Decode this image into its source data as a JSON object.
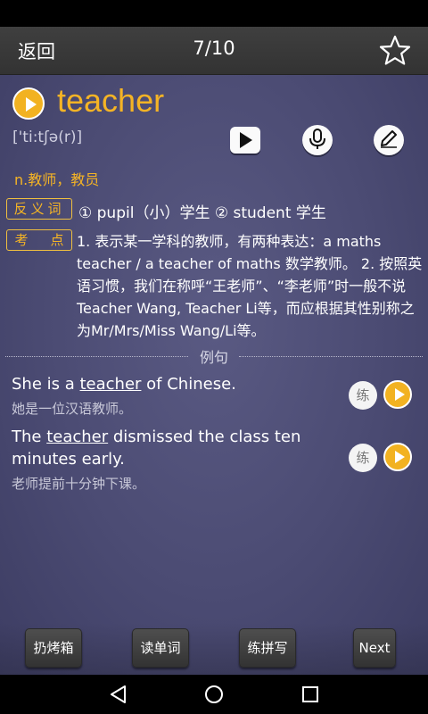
{
  "header": {
    "back_label": "返回",
    "progress": "7/10"
  },
  "word": {
    "text": "teacher",
    "phonetic": "['ti:tʃə(r)]",
    "pos_meaning": "n.教师，教员"
  },
  "antonym": {
    "tag": "反义词",
    "text": "① pupil（小）学生 ② student 学生"
  },
  "key_point": {
    "tag_left": "考",
    "tag_right": "点",
    "text": "1. 表示某一学科的教师，有两种表达：a maths teacher / a teacher of maths 数学教师。 2. 按照英语习惯，我们在称呼“王老师”、“李老师”时一般不说Teacher Wang, Teacher Li等，而应根据其性别称之为Mr/Mrs/Miss Wang/Li等。"
  },
  "examples_heading": "例句",
  "examples": [
    {
      "en_before": "She is a ",
      "en_word": "teacher",
      "en_after": " of Chinese.",
      "cn": "她是一位汉语教师。",
      "practice_label": "练"
    },
    {
      "en_before": "The ",
      "en_word": "teacher",
      "en_after": " dismissed the class ten minutes early.",
      "cn": "老师提前十分钟下课。",
      "practice_label": "练"
    }
  ],
  "bottom_buttons": {
    "discard": "扔烤箱",
    "read": "读单词",
    "spell": "练拼写",
    "next": "Next"
  },
  "icons": {
    "star": "star-icon",
    "play": "play-icon",
    "mic": "microphone-icon",
    "edit": "pencil-icon",
    "nav_back": "triangle-back-icon",
    "nav_home": "circle-home-icon",
    "nav_recent": "square-recent-icon"
  },
  "colors": {
    "accent": "#f5b425",
    "background": "#4b4b73"
  }
}
